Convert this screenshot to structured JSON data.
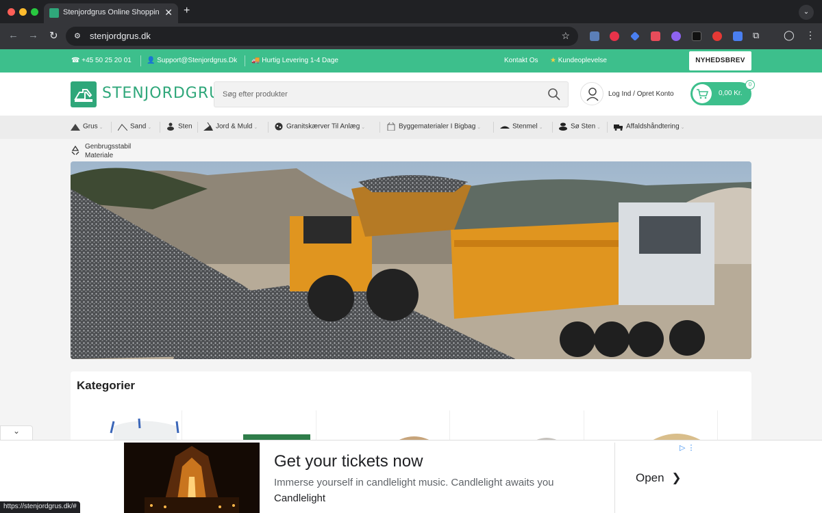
{
  "browser": {
    "tab_title": "Stenjordgrus Online Shopping",
    "tab_close": "✕",
    "new_tab": "+",
    "url": "stenjordgrus.dk",
    "status_url": "https://stenjordgrus.dk/#",
    "colors": {
      "chrome_dark": "#202124",
      "chrome_mid": "#35363a"
    }
  },
  "topbar": {
    "phone": "+45 50 25 20 01",
    "email": "Support@Stenjordgrus.Dk",
    "delivery": "Hurtig Levering 1-4 Dage",
    "contact": "Kontakt Os",
    "reviews": "Kundeoplevelse",
    "newsletter": "NYHEDSBREV"
  },
  "header": {
    "logo": "STENJORDGRUS",
    "search_placeholder": "Søg efter produkter",
    "login": "Log Ind / Opret Konto",
    "cart_total": "0,00 Kr.",
    "cart_count": "0"
  },
  "nav": {
    "items": [
      {
        "label": "Grus",
        "icon": "gravel-pile-icon"
      },
      {
        "label": "Sand",
        "icon": "sand-icon"
      },
      {
        "label": "Sten",
        "icon": "stones-icon"
      },
      {
        "label": "Jord & Muld",
        "icon": "soil-icon"
      },
      {
        "label": "Granitskærver Til Anlæg",
        "icon": "granite-icon"
      },
      {
        "label": "Byggematerialer I Bigbag",
        "icon": "bigbag-icon"
      },
      {
        "label": "Stenmel",
        "icon": "stone-flour-icon"
      },
      {
        "label": "Sø Sten",
        "icon": "lake-stones-icon"
      },
      {
        "label": "Affaldshåndtering",
        "icon": "waste-truck-icon"
      }
    ],
    "second_row": {
      "line1": "Genbrugsstabil",
      "line2": "Materiale",
      "icon": "recycle-icon"
    }
  },
  "categories": {
    "title": "Kategorier"
  },
  "ad": {
    "headline": "Get your tickets now",
    "description": "Immerse yourself in candlelight music. Candlelight awaits you",
    "brand": "Candlelight",
    "cta": "Open"
  },
  "theme": {
    "brand_green": "#3dbf8c",
    "logo_green": "#2fa77a"
  }
}
